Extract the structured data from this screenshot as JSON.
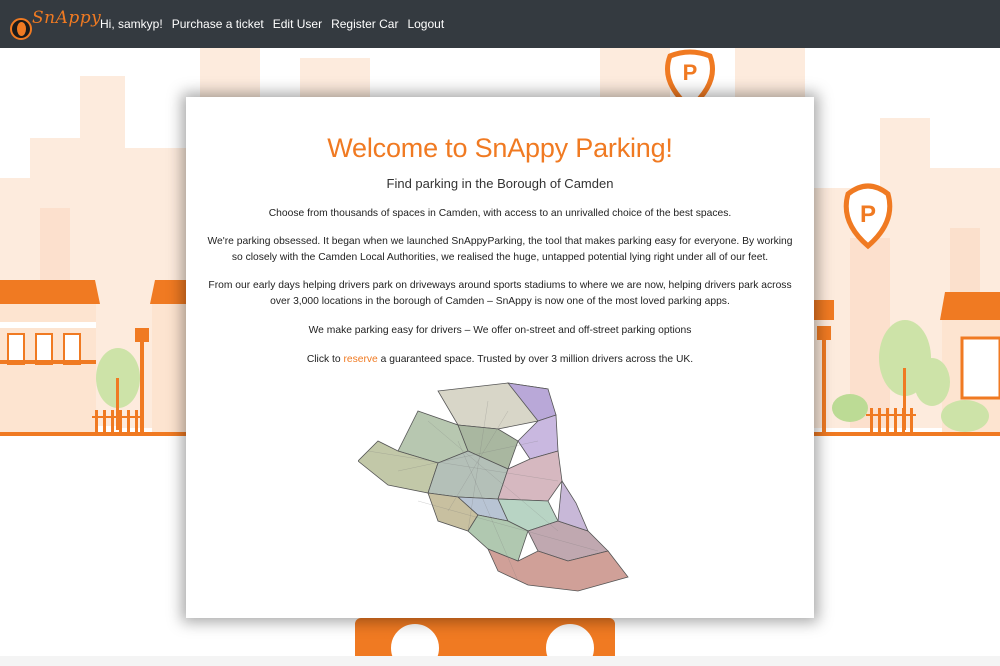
{
  "nav": {
    "brand": "SnAppy",
    "greeting": "Hi, samkyp!",
    "purchase": "Purchase a ticket",
    "edit_user": "Edit User",
    "register_car": "Register Car",
    "logout": "Logout"
  },
  "card": {
    "title": "Welcome to SnAppy Parking!",
    "subtitle": "Find parking in the Borough of Camden",
    "p1": "Choose from thousands of spaces in Camden, with access to an unrivalled choice of the best spaces.",
    "p2": "We're parking obsessed. It began when we launched SnAppyParking, the tool that makes parking easy for everyone. By working so closely with the Camden Local Authorities, we realised the huge, untapped potential lying right under all of our feet.",
    "p3": "From our early days helping drivers park on driveways around sports stadiums to where we are now, helping drivers park across over 3,000 locations in the borough of Camden – SnAppy is now one of the most loved parking apps.",
    "p4": "We make parking easy for drivers – We offer on-street and off-street parking options",
    "p5_before": "Click to ",
    "p5_link": "reserve",
    "p5_after": " a guaranteed space. Trusted by over 3 million drivers across the UK."
  },
  "colors": {
    "accent": "#f07a22",
    "navbar": "#343a40"
  }
}
